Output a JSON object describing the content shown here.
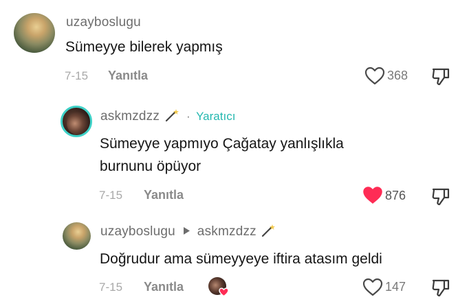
{
  "comments": [
    {
      "username": "uzayboslugu",
      "text": "Sümeyye bilerek yapmış",
      "date": "7-15",
      "reply_label": "Yanıtla",
      "like_count": "368",
      "liked": false
    }
  ],
  "creator_reply": {
    "username": "askmzdzz",
    "separator": "·",
    "creator_label": "Yaratıcı",
    "text_line1": "Sümeyye yapmıyo Çağatay yanlışlıkla",
    "text_line2": "burnunu öpüyor",
    "date": "7-15",
    "reply_label": "Yanıtla",
    "like_count": "876",
    "liked": true,
    "like_color": "#fe2c55"
  },
  "nested_reply": {
    "username": "uzayboslugu",
    "reply_to": "askmzdzz",
    "text": "Doğrudur ama sümeyyeye iftira atasım geldi",
    "date": "7-15",
    "reply_label": "Yanıtla",
    "like_count": "147",
    "liked": false
  },
  "icons": {
    "heart": "heart-icon",
    "dislike": "thumbs-down-icon",
    "wand": "magic-wand-icon",
    "reply_arrow": "play-arrow-icon"
  }
}
